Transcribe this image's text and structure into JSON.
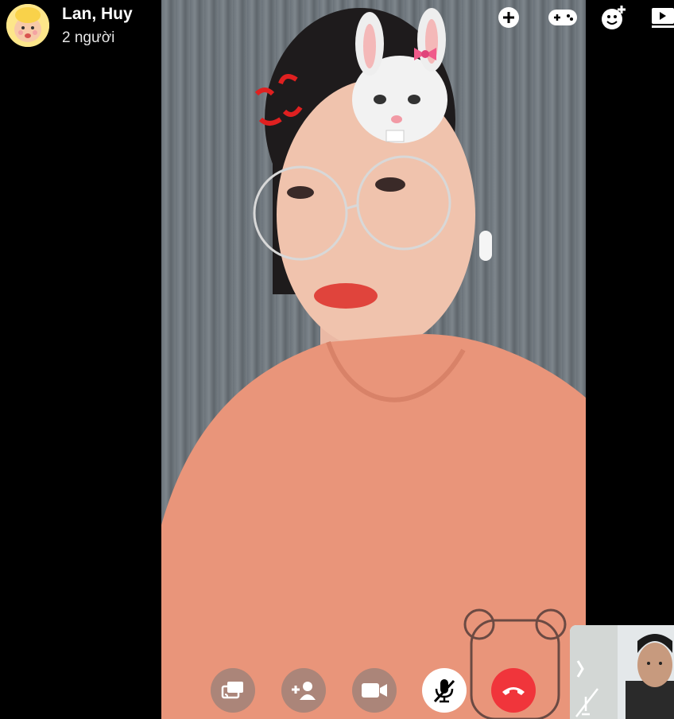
{
  "header": {
    "title": "Lan, Huy",
    "subtitle": "2 người"
  },
  "top_toolbar": [
    {
      "name": "add-icon"
    },
    {
      "name": "game-controller-icon"
    },
    {
      "name": "add-effect-icon"
    },
    {
      "name": "watch-together-icon"
    }
  ],
  "call_controls": [
    {
      "name": "share-screen-icon"
    },
    {
      "name": "add-person-icon"
    },
    {
      "name": "video-camera-icon"
    },
    {
      "name": "microphone-muted-icon"
    },
    {
      "name": "end-call-icon"
    }
  ],
  "colors": {
    "background": "#000000",
    "end_call": "#f0353b",
    "control_bg": "#787878",
    "shirt": "#e9957a"
  }
}
